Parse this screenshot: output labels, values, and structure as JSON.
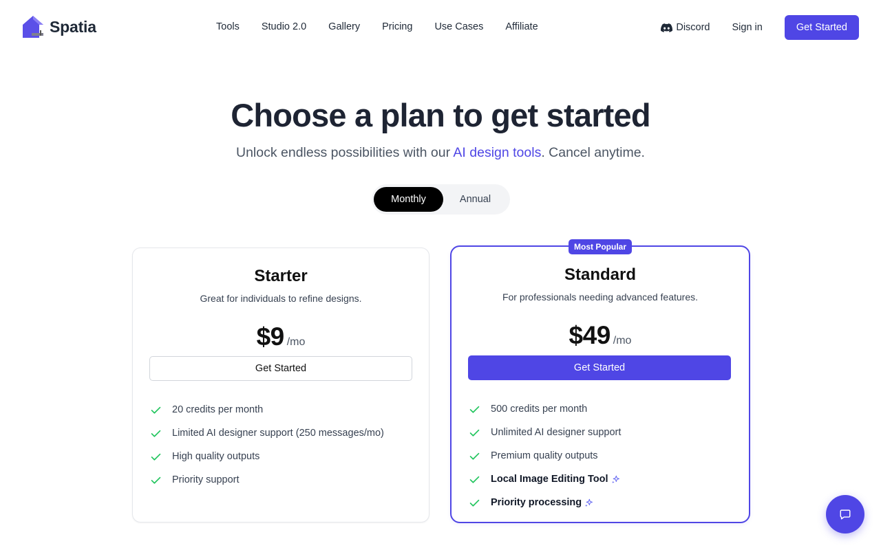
{
  "nav": {
    "logo_text": "Spatia",
    "links": [
      "Tools",
      "Studio 2.0",
      "Gallery",
      "Pricing",
      "Use Cases",
      "Affiliate"
    ],
    "discord_label": "Discord",
    "signin_label": "Sign in",
    "cta_label": "Get Started"
  },
  "hero": {
    "title": "Choose a plan to get started",
    "subtitle_before": "Unlock endless possibilities with our ",
    "subtitle_link": "AI design tools",
    "subtitle_after": ". Cancel anytime."
  },
  "billing_toggle": {
    "options": [
      "Monthly",
      "Annual"
    ],
    "selected": "Monthly"
  },
  "plans": [
    {
      "name": "Starter",
      "description": "Great for individuals to refine designs.",
      "price": "$9",
      "period": "/mo",
      "cta": "Get Started",
      "features": [
        "20 credits per month",
        "Limited AI designer support (250 messages/mo)",
        "High quality outputs",
        "Priority support"
      ]
    },
    {
      "name": "Standard",
      "badge": "Most Popular",
      "description": "For professionals needing advanced features.",
      "price": "$49",
      "period": "/mo",
      "cta": "Get Started",
      "features": [
        "500 credits per month",
        "Unlimited AI designer support",
        "Premium quality outputs",
        "Local Image Editing Tool",
        "Priority processing"
      ]
    }
  ],
  "colors": {
    "accent": "#4f46e5",
    "check": "#22c55e",
    "text_dark": "#1e2433"
  },
  "icons": {
    "logo": "house-logo-icon",
    "discord": "discord-icon",
    "check": "check-icon",
    "sparkle": "sparkle-icon",
    "chat": "chat-bubble-icon"
  }
}
